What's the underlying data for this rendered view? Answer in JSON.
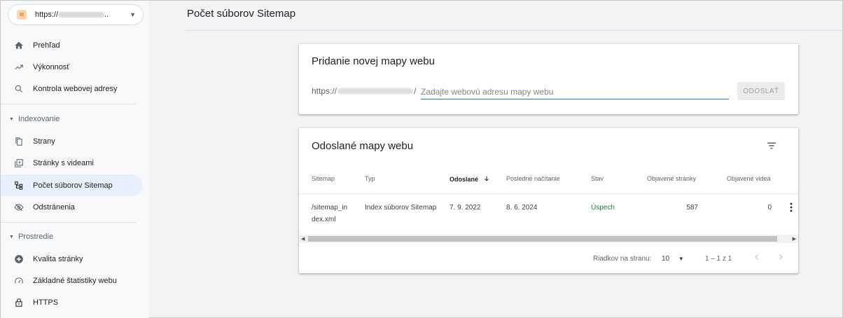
{
  "property": {
    "url_prefix": "https://",
    "url_suffix": ".."
  },
  "nav": {
    "overview": "Prehľad",
    "performance": "Výkonnosť",
    "url_inspection": "Kontrola webovej adresy",
    "indexing_section": "Indexovanie",
    "pages": "Strany",
    "video_pages": "Stránky s videami",
    "sitemaps": "Počet súborov Sitemap",
    "removals": "Odstránenia",
    "experience_section": "Prostredie",
    "page_experience": "Kvalita stránky",
    "core_web_vitals": "Základné štatistiky webu",
    "https": "HTTPS"
  },
  "page_title": "Počet súborov Sitemap",
  "add_card": {
    "title": "Pridanie novej mapy webu",
    "url_prefix_start": "https://",
    "url_prefix_end": "/",
    "input_placeholder": "Zadajte webovú adresu mapy webu",
    "submit_label": "ODOSLAŤ"
  },
  "submitted_card": {
    "title": "Odoslané mapy webu",
    "columns": {
      "sitemap": "Sitemap",
      "type": "Typ",
      "submitted": "Odoslané",
      "last_read": "Posledné načítanie",
      "status": "Stav",
      "discovered_pages": "Objavené stránky",
      "discovered_videos": "Objavené videá"
    },
    "rows": [
      {
        "sitemap_l1": "/sitemap_in",
        "sitemap_l2": "dex.xml",
        "type": "Index súborov Sitemap",
        "submitted": "7. 9. 2022",
        "last_read": "8. 6. 2024",
        "status": "Úspech",
        "pages": "587",
        "videos": "0"
      }
    ],
    "pagination": {
      "rows_per_page_label": "Riadkov na stranu:",
      "rows_per_page_value": "10",
      "range": "1 – 1 z 1"
    }
  },
  "colors": {
    "accent": "#1a73e8",
    "success": "#188038",
    "active_bg": "#e8f0fe"
  }
}
